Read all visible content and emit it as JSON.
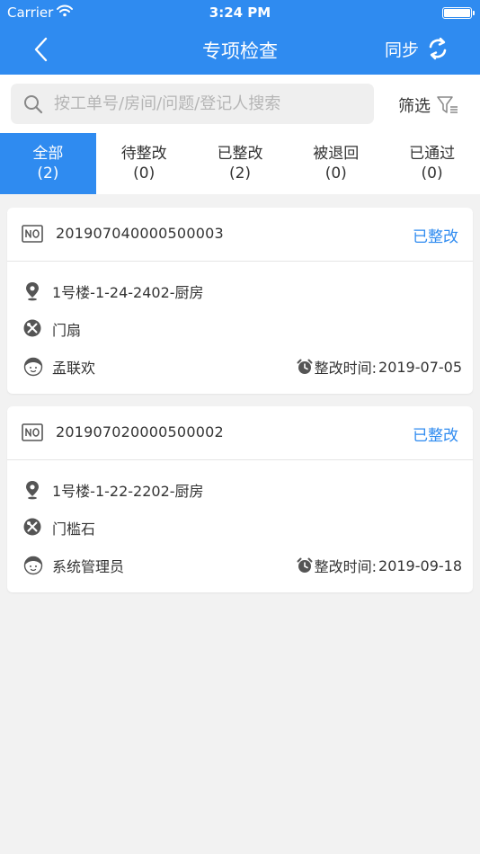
{
  "status_bar": {
    "carrier": "Carrier",
    "time": "3:24 PM",
    "battery_level": 1.0
  },
  "navbar": {
    "title": "专项检查",
    "sync_label": "同步"
  },
  "search": {
    "placeholder": "按工单号/房间/问题/登记人搜索",
    "filter_label": "筛选"
  },
  "tabs": [
    {
      "label": "全部",
      "count": "(2)"
    },
    {
      "label": "待整改",
      "count": "(0)"
    },
    {
      "label": "已整改",
      "count": "(2)"
    },
    {
      "label": "被退回",
      "count": "(0)"
    },
    {
      "label": "已通过",
      "count": "(0)"
    }
  ],
  "items": [
    {
      "order_no": "201907040000500003",
      "status": "已整改",
      "location": "1号楼-1-24-2402-厨房",
      "problem": "门扇",
      "registrant": "孟联欢",
      "time_label": "整改时间:",
      "time": "2019-07-05"
    },
    {
      "order_no": "201907020000500002",
      "status": "已整改",
      "location": "1号楼-1-22-2202-厨房",
      "problem": "门槛石",
      "registrant": "系统管理员",
      "time_label": "整改时间:",
      "time": "2019-09-18"
    }
  ],
  "colors": {
    "primary": "#2f8bf0",
    "background": "#f2f2f2",
    "icon_gray": "#555555"
  }
}
